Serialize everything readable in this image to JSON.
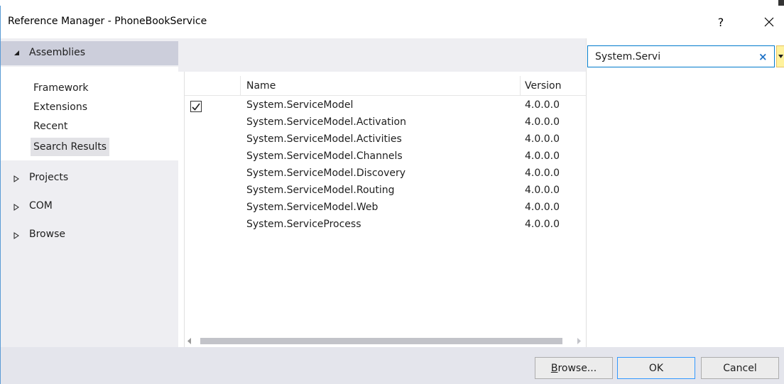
{
  "window": {
    "title": "Reference Manager - PhoneBookService",
    "help_label": "?",
    "close_label": "×"
  },
  "sidebar": {
    "header": "Assemblies",
    "items": [
      {
        "label": "Framework"
      },
      {
        "label": "Extensions"
      },
      {
        "label": "Recent"
      },
      {
        "label": "Search Results",
        "selected": true
      }
    ],
    "groups": [
      {
        "label": "Projects"
      },
      {
        "label": "COM"
      },
      {
        "label": "Browse"
      }
    ]
  },
  "search": {
    "value": "System.Servi",
    "clear_label": "×"
  },
  "list": {
    "columns": [
      "Name",
      "Version"
    ],
    "rows": [
      {
        "checked": true,
        "name": "System.ServiceModel",
        "version": "4.0.0.0"
      },
      {
        "checked": false,
        "name": "System.ServiceModel.Activation",
        "version": "4.0.0.0"
      },
      {
        "checked": false,
        "name": "System.ServiceModel.Activities",
        "version": "4.0.0.0"
      },
      {
        "checked": false,
        "name": "System.ServiceModel.Channels",
        "version": "4.0.0.0"
      },
      {
        "checked": false,
        "name": "System.ServiceModel.Discovery",
        "version": "4.0.0.0"
      },
      {
        "checked": false,
        "name": "System.ServiceModel.Routing",
        "version": "4.0.0.0"
      },
      {
        "checked": false,
        "name": "System.ServiceModel.Web",
        "version": "4.0.0.0"
      },
      {
        "checked": false,
        "name": "System.ServiceProcess",
        "version": "4.0.0.0"
      }
    ]
  },
  "footer": {
    "browse_label": "Browse...",
    "ok_label": "OK",
    "cancel_label": "Cancel"
  },
  "colors": {
    "accent": "#007acc",
    "nav_background": "#eeeef2",
    "nav_selected": "#cccedb",
    "footer_background": "#e4e5ec"
  }
}
